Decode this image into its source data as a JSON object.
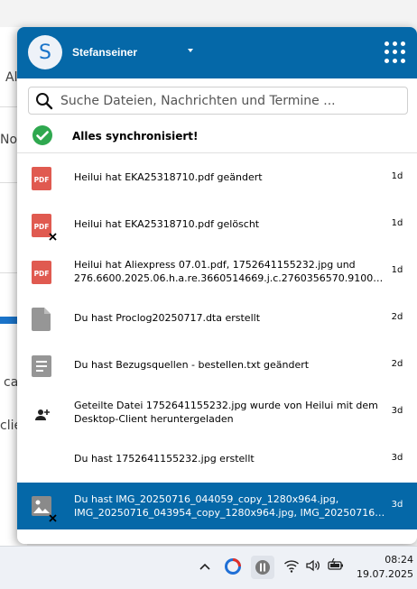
{
  "background": {
    "fragments": [
      "Al",
      "No",
      "ca",
      "clie"
    ]
  },
  "header": {
    "avatar_letter": "S",
    "username": "Stefanseiner",
    "accent": "#0568a8"
  },
  "search": {
    "placeholder": "Suche Dateien, Nachrichten und Termine ..."
  },
  "status": {
    "text": "Alles synchronisiert!",
    "icon": "check-circle-icon"
  },
  "activities": [
    {
      "icon": "pdf-icon",
      "lines": [
        "Heilui hat EKA25318710.pdf geändert"
      ],
      "age": "1d"
    },
    {
      "icon": "pdf-deleted-icon",
      "lines": [
        "Heilui hat EKA25318710.pdf gelöscht"
      ],
      "age": "1d"
    },
    {
      "icon": "pdf-icon",
      "lines": [
        "Heilui hat Aliexpress 07.01.pdf, 1752641155232.jpg und",
        "276.6600.2025.06.h.a.re.3660514669.j.c.2760356570.91009…"
      ],
      "age": "1d"
    },
    {
      "icon": "file-icon",
      "lines": [
        "Du hast Proclog20250717.dta erstellt"
      ],
      "age": "2d"
    },
    {
      "icon": "text-file-icon",
      "lines": [
        "Du hast Bezugsquellen - bestellen.txt geändert"
      ],
      "age": "2d"
    },
    {
      "icon": "person-add-icon",
      "lines": [
        "Geteilte Datei 1752641155232.jpg wurde von Heilui mit dem",
        "Desktop-Client heruntergeladen"
      ],
      "age": "3d"
    },
    {
      "icon": "none",
      "lines": [
        "Du hast 1752641155232.jpg erstellt"
      ],
      "age": "3d"
    },
    {
      "icon": "image-deleted-icon",
      "lines": [
        "Du hast IMG_20250716_044059_copy_1280x964.jpg,",
        "IMG_20250716_043954_copy_1280x964.jpg, IMG_20250716_…"
      ],
      "age": "3d"
    }
  ],
  "taskbar": {
    "time": "08:24",
    "date": "19.07.2025"
  }
}
